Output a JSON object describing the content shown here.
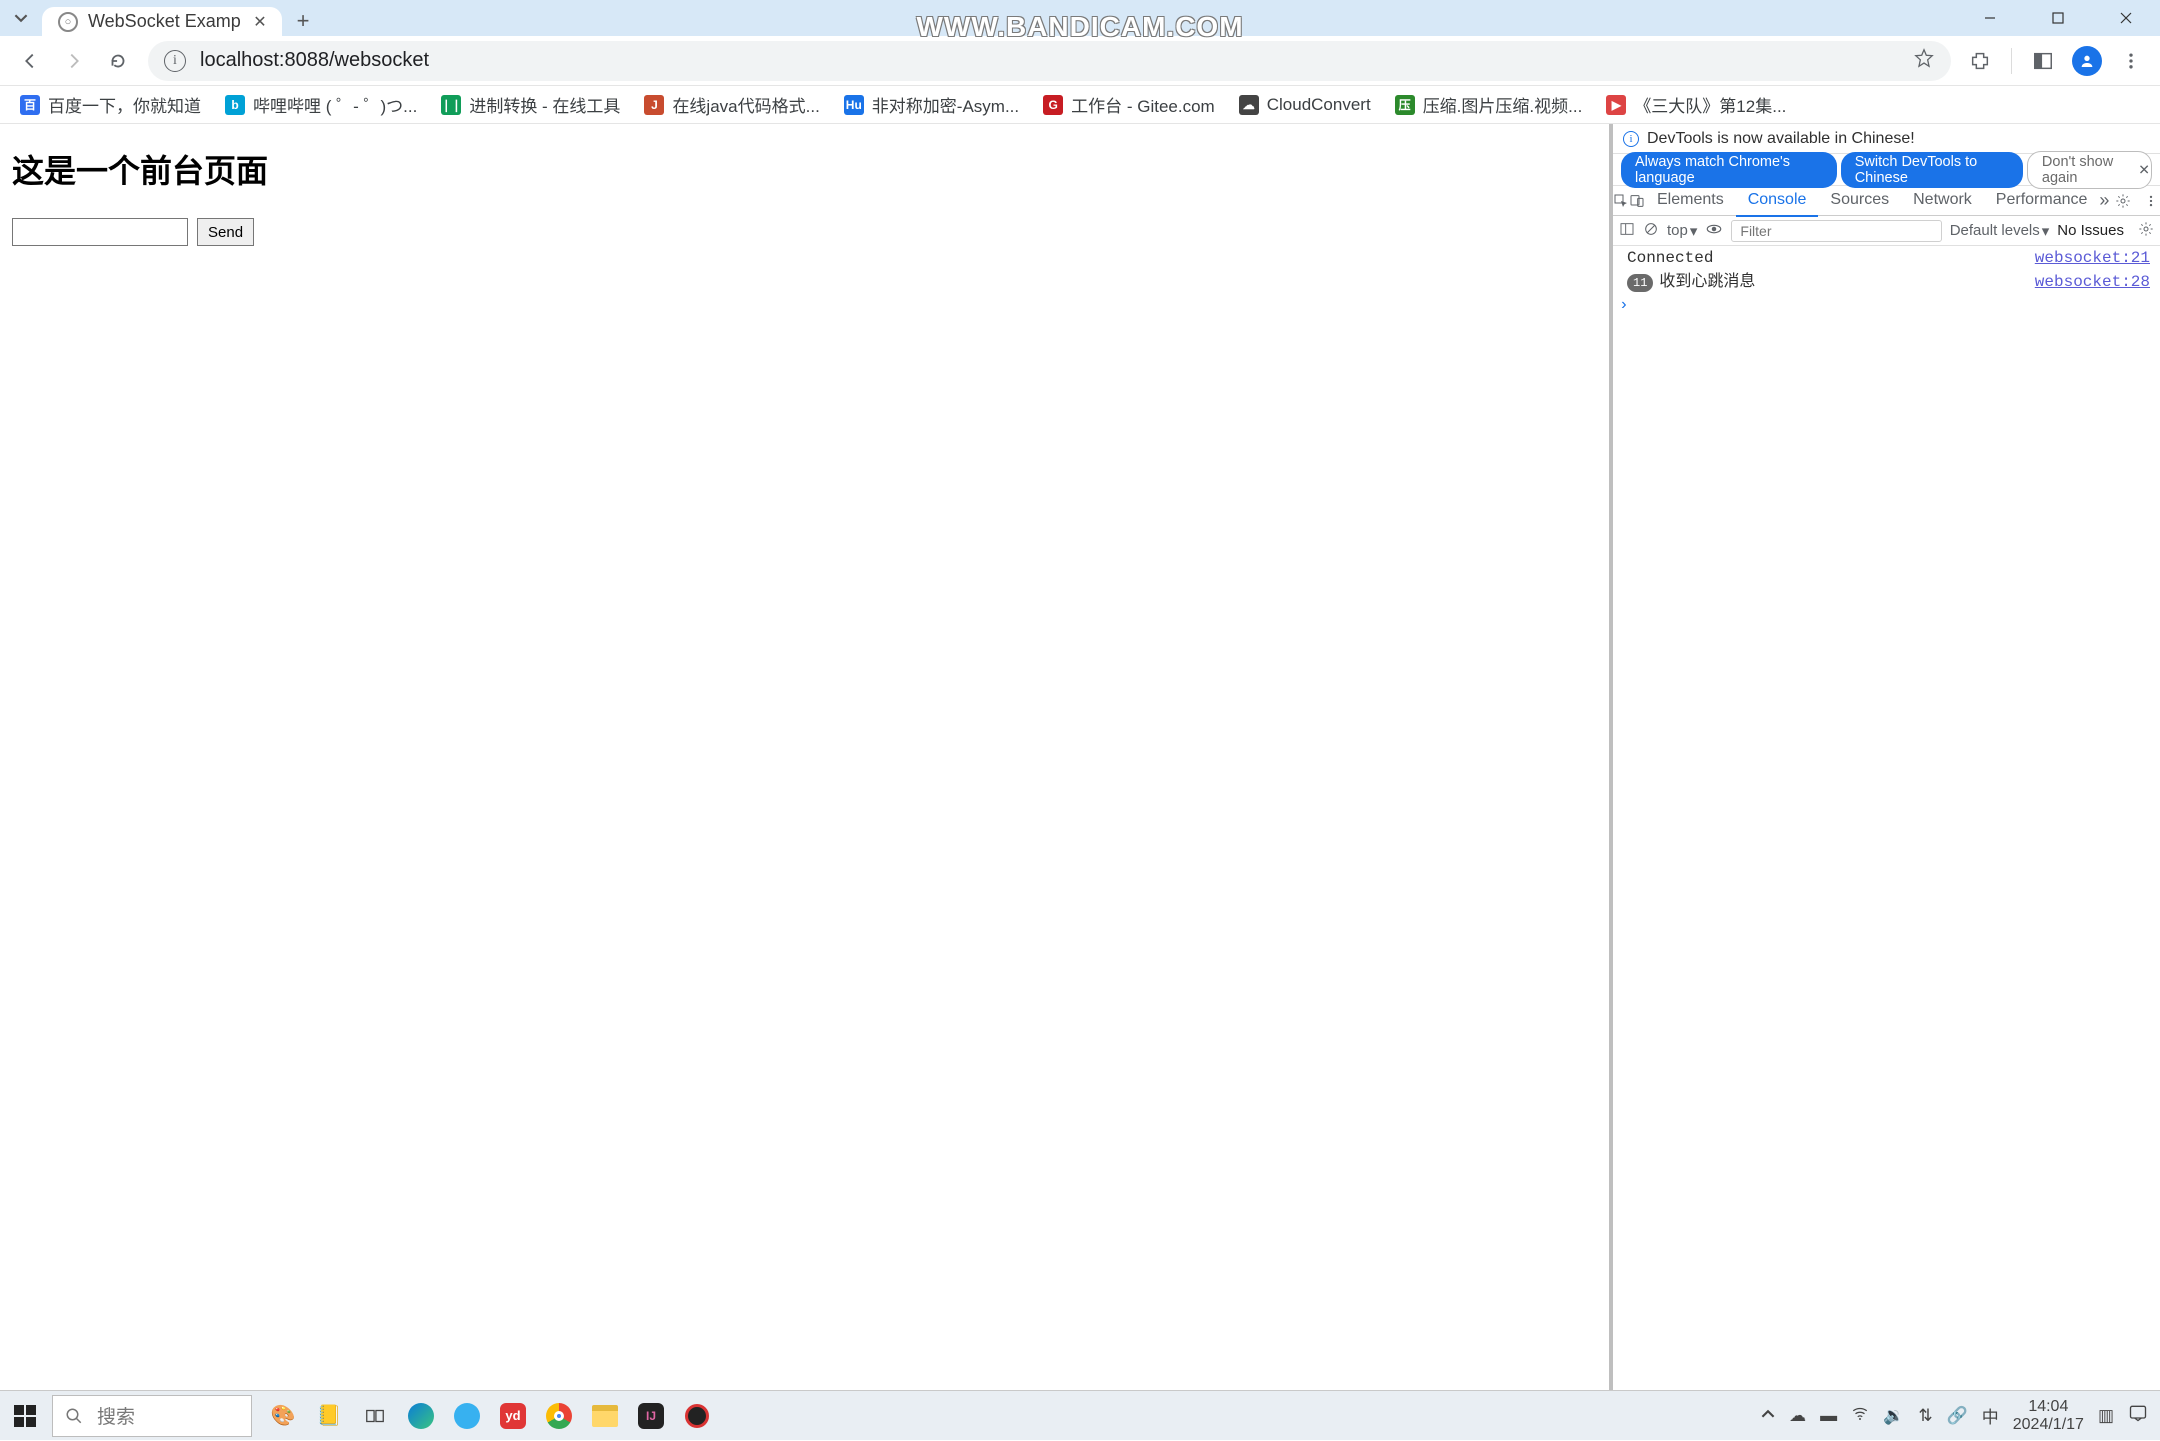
{
  "watermark": "WWW.BANDICAM.COM",
  "window": {
    "tab_title": "WebSocket Example",
    "url": "localhost:8088/websocket"
  },
  "bookmarks": [
    {
      "label": "百度一下，你就知道",
      "color": "#2f6ef0",
      "glyph": "百"
    },
    {
      "label": "哔哩哔哩 ( ゜- ゜)つ...",
      "color": "#00a1d6",
      "glyph": "b"
    },
    {
      "label": "进制转换 - 在线工具",
      "color": "#109d59",
      "glyph": "❘❘"
    },
    {
      "label": "在线java代码格式...",
      "color": "#c84c2f",
      "glyph": "J"
    },
    {
      "label": "非对称加密-Asym...",
      "color": "#1a73e8",
      "glyph": "Hu"
    },
    {
      "label": "工作台 - Gitee.com",
      "color": "#c71d23",
      "glyph": "G"
    },
    {
      "label": "CloudConvert",
      "color": "#444",
      "glyph": "☁"
    },
    {
      "label": "压缩.图片压缩.视频...",
      "color": "#2c8a2c",
      "glyph": "压"
    },
    {
      "label": "《三大队》第12集...",
      "color": "#d44",
      "glyph": "▶"
    }
  ],
  "page": {
    "heading": "这是一个前台页面",
    "send_label": "Send"
  },
  "devtools": {
    "notify": "DevTools is now available in Chinese!",
    "pill1": "Always match Chrome's language",
    "pill2": "Switch DevTools to Chinese",
    "pill3": "Don't show again",
    "tabs": [
      "Elements",
      "Console",
      "Sources",
      "Network",
      "Performance"
    ],
    "active_tab": "Console",
    "context": "top",
    "filter_placeholder": "Filter",
    "levels": "Default levels",
    "issues": "No Issues",
    "log": [
      {
        "badge": "",
        "msg": "Connected",
        "link": "websocket:21"
      },
      {
        "badge": "11",
        "msg": "收到心跳消息",
        "link": "websocket:28"
      }
    ]
  },
  "taskbar": {
    "search_placeholder": "搜索",
    "ime": "中",
    "time": "14:04",
    "date": "2024/1/17"
  }
}
